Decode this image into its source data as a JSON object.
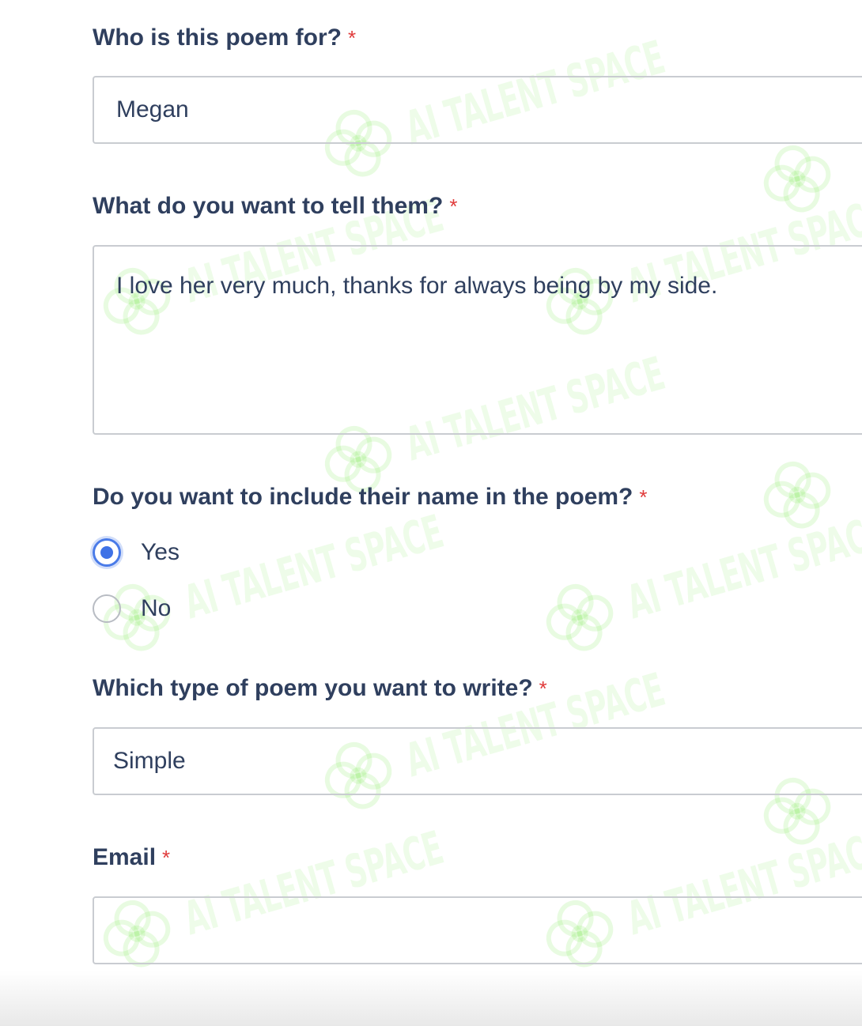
{
  "watermark": {
    "text": "AI TALENT SPACE",
    "logo_icon": "clover-logo-icon",
    "color": "#96eb78"
  },
  "form": {
    "recipient": {
      "label": "Who is this poem for?",
      "required_mark": "*",
      "value": "Megan"
    },
    "message": {
      "label": "What do you want to tell them?",
      "required_mark": "*",
      "value": "I love her very much, thanks for always being by my side."
    },
    "include_name": {
      "label": "Do you want to include their name in the poem?",
      "required_mark": "*",
      "options": [
        {
          "label": "Yes",
          "checked": true
        },
        {
          "label": "No",
          "checked": false
        }
      ]
    },
    "poem_type": {
      "label": "Which type of poem you want to write?",
      "required_mark": "*",
      "selected": "Simple"
    },
    "email": {
      "label": "Email",
      "required_mark": "*",
      "value": ""
    }
  },
  "colors": {
    "label": "#2f3f5e",
    "required": "#e03b3b",
    "radio_accent": "#3f72e6",
    "border": "#c9ccd1"
  }
}
